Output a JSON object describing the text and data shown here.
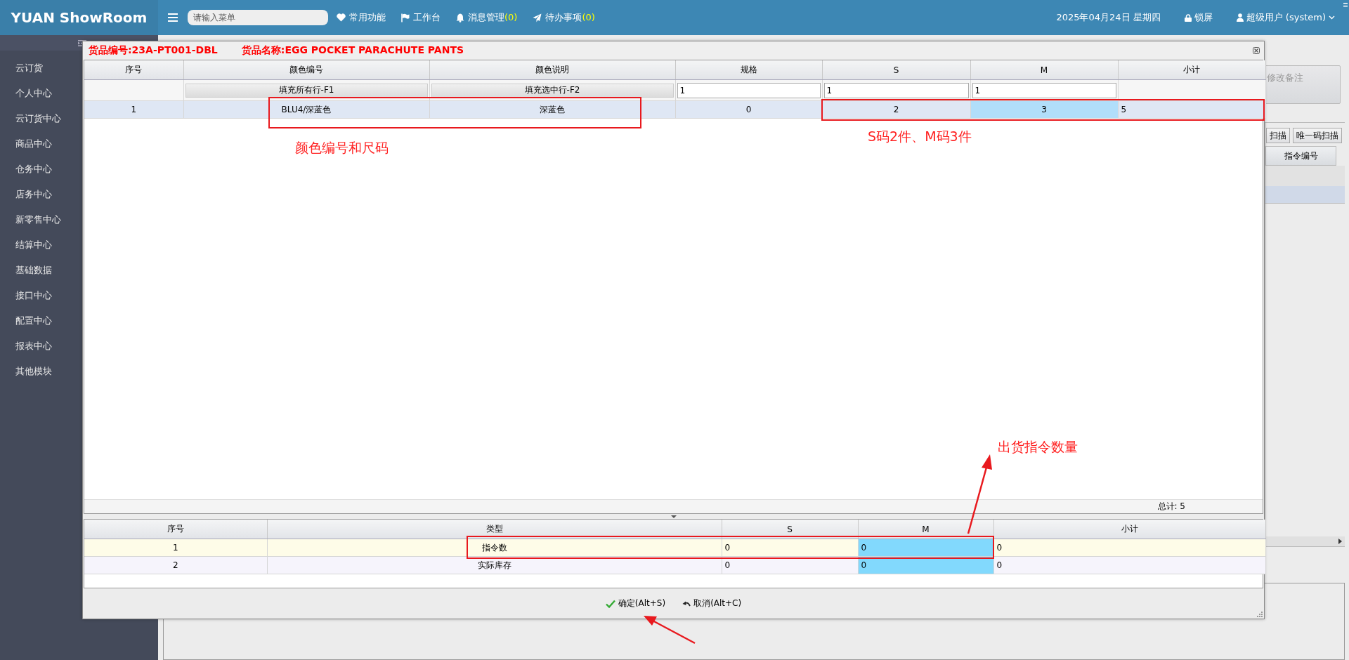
{
  "topbar": {
    "logo": "YUAN ShowRoom",
    "search": {
      "placeholder": "请输入菜单"
    },
    "nav": [
      {
        "label": "常用功能"
      },
      {
        "label": "工作台"
      },
      {
        "label": "消息管理",
        "count": "(0)"
      },
      {
        "label": "待办事项",
        "count": "(0)"
      }
    ],
    "date": "2025年04月24日 星期四",
    "lock": "锁屏",
    "user": "超级用户 (system)"
  },
  "sidebar": {
    "items": [
      "云订货",
      "个人中心",
      "云订货中心",
      "商品中心",
      "仓务中心",
      "店务中心",
      "新零售中心",
      "结算中心",
      "基础数据",
      "接口中心",
      "配置中心",
      "报表中心",
      "其他模块"
    ]
  },
  "background_panel": {
    "remark_button": "修改备注",
    "buttons": [
      "扫描",
      "唯一码扫描"
    ],
    "column": "指令编号"
  },
  "dialog": {
    "code_label": "货品编号:23A-PT001-DBL",
    "name_label": "货品名称:EGG POCKET PARACHUTE PANTS",
    "upper_table": {
      "columns": [
        {
          "label": "序号",
          "highlighted": false
        },
        {
          "label": "颜色编号",
          "highlighted": false
        },
        {
          "label": "颜色说明",
          "highlighted": false
        },
        {
          "label": "规格",
          "highlighted": false
        },
        {
          "label": "S",
          "highlighted": false
        },
        {
          "label": "M",
          "highlighted": true
        },
        {
          "label": "小计",
          "highlighted": false
        }
      ],
      "fill_buttons": [
        "填充所有行-F1",
        "填充选中行-F2"
      ],
      "fill_inputs": [
        "1",
        "1",
        "1"
      ],
      "rows": [
        {
          "selected": true,
          "cells": [
            "1",
            "BLU4/深蓝色",
            "深蓝色",
            "0",
            "2",
            "3",
            "5"
          ]
        }
      ]
    },
    "total": "总计: 5",
    "lower_table": {
      "columns": [
        {
          "label": "序号",
          "highlighted": false
        },
        {
          "label": "类型",
          "highlighted": false
        },
        {
          "label": "S",
          "highlighted": false
        },
        {
          "label": "M",
          "highlighted": true
        },
        {
          "label": "小计",
          "highlighted": false
        }
      ],
      "rows": [
        {
          "selected": true,
          "cells": [
            "1",
            "指令数",
            "0",
            "0",
            "0"
          ]
        },
        {
          "selected": false,
          "cells": [
            "2",
            "实际库存",
            "0",
            "0",
            "0"
          ]
        }
      ]
    },
    "buttons": [
      {
        "kind": "confirm",
        "label": "确定(Alt+S)"
      },
      {
        "kind": "cancel",
        "label": "取消(Alt+C)"
      }
    ]
  },
  "annotations": [
    "颜色编号和尺码",
    "S码2件、M码3件",
    "出货指令数量"
  ]
}
